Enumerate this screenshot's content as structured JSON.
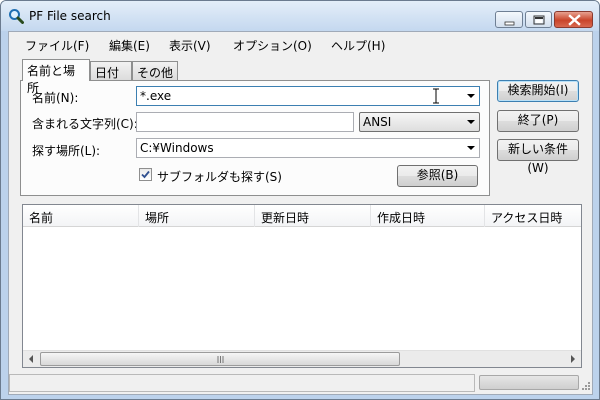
{
  "window": {
    "title": "PF File search"
  },
  "menu": [
    {
      "label": "ファイル(F)"
    },
    {
      "label": "編集(E)"
    },
    {
      "label": "表示(V)"
    },
    {
      "label": "オプション(O)"
    },
    {
      "label": "ヘルプ(H)"
    }
  ],
  "tabs": [
    {
      "label": "名前と場所",
      "active": true
    },
    {
      "label": "日付",
      "active": false
    },
    {
      "label": "その他",
      "active": false
    }
  ],
  "form": {
    "name_label": "名前(N):",
    "name_value": "*.exe",
    "contains_label": "含まれる文字列(C):",
    "contains_value": "",
    "encoding_value": "ANSI",
    "location_label": "探す場所(L):",
    "location_value": "C:¥Windows",
    "subfolders_label": "サブフォルダも探す(S)",
    "subfolders_checked": true,
    "browse_label": "参照(B)"
  },
  "actions": {
    "start_label": "検索開始(I)",
    "exit_label": "終了(P)",
    "new_label": "新しい条件(W)"
  },
  "results": {
    "columns": [
      {
        "label": "名前"
      },
      {
        "label": "場所"
      },
      {
        "label": "更新日時"
      },
      {
        "label": "作成日時"
      },
      {
        "label": "アクセス日時"
      }
    ],
    "rows": []
  },
  "status": {
    "text": ""
  },
  "colors": {
    "accent": "#3c7fb1",
    "close_button": "#c9452b"
  }
}
